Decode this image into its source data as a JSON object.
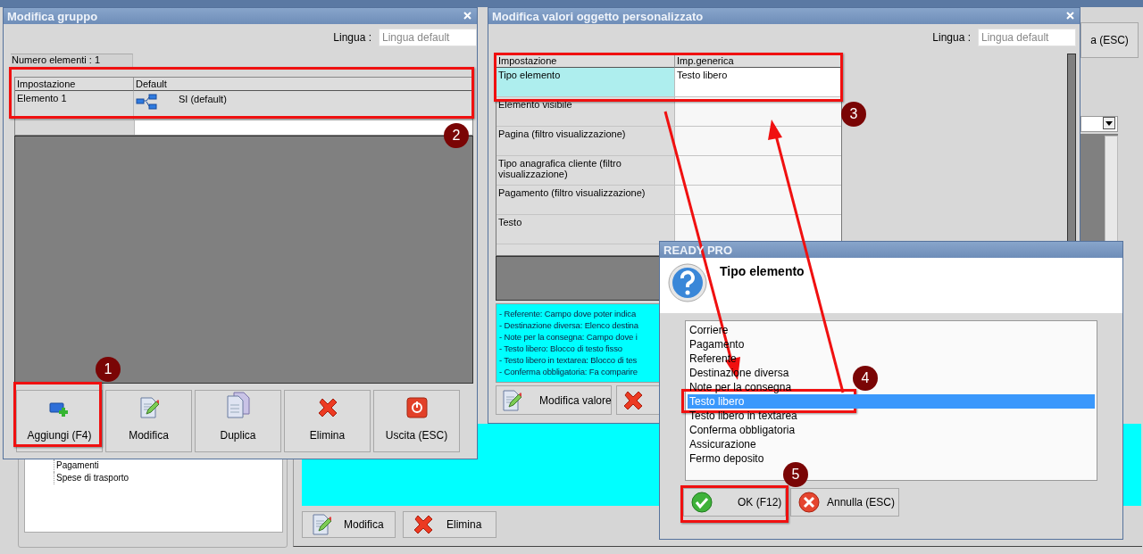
{
  "background_app": {
    "tree_items": [
      {
        "label": "Pagamenti"
      },
      {
        "label": "Spese di trasporto"
      }
    ],
    "top_right_button": "a (ESC)",
    "buttons": [
      {
        "label": "Modifica",
        "kind": "edit"
      },
      {
        "label": "Elimina",
        "kind": "delete"
      }
    ]
  },
  "group_window": {
    "title": "Modifica gruppo",
    "language_label": "Lingua :",
    "language_placeholder": "Lingua default",
    "count": "Numero elementi : 1",
    "table": {
      "columns": [
        "Impostazione",
        "Default"
      ],
      "rows": [
        {
          "cells": [
            "Elemento 1",
            "SI (default)"
          ]
        }
      ]
    },
    "buttons": [
      {
        "label": "Aggiungi (F4)",
        "kind": "add"
      },
      {
        "label": "Modifica",
        "kind": "edit"
      },
      {
        "label": "Duplica",
        "kind": "duplicate"
      },
      {
        "label": "Elimina",
        "kind": "delete"
      },
      {
        "label": "Uscita (ESC)",
        "kind": "exit"
      }
    ]
  },
  "values_window": {
    "title": "Modifica valori oggetto personalizzato",
    "language_label": "Lingua :",
    "language_placeholder": "Lingua default",
    "table": {
      "columns": [
        "Impostazione",
        "Imp.generica"
      ],
      "rows": [
        {
          "cells": [
            "Tipo elemento",
            "Testo libero"
          ],
          "selected": true
        },
        {
          "cells": [
            "Elemento visibile"
          ],
          "selected": false
        },
        {
          "cells": [
            "Pagina (filtro visualizzazione)"
          ],
          "selected": false
        },
        {
          "cells": [
            "Tipo anagrafica cliente (filtro visualizzazione)"
          ],
          "selected": false
        },
        {
          "cells": [
            "Pagamento (filtro visualizzazione)"
          ],
          "selected": false
        },
        {
          "cells": [
            "Testo"
          ],
          "selected": false
        }
      ]
    },
    "help_lines": [
      "- Referente: Campo dove poter indica",
      "- Destinazione diversa: Elenco destina",
      "- Note per la consegna: Campo dove i",
      "- Testo libero: Blocco di testo fisso",
      "- Testo libero in textarea: Blocco di tes",
      "- Conferma obbligatoria: Fa comparire"
    ],
    "buttons": [
      {
        "label": "Modifica valore",
        "kind": "edit"
      },
      {
        "kind": "delete"
      }
    ]
  },
  "dialog": {
    "title": "READY PRO",
    "heading": "Tipo elemento",
    "options": [
      {
        "label": "Corriere",
        "selected": false
      },
      {
        "label": "Pagamento",
        "selected": false
      },
      {
        "label": "Referente",
        "selected": false
      },
      {
        "label": "Destinazione diversa",
        "selected": false
      },
      {
        "label": "Note per la consegna",
        "selected": false
      },
      {
        "label": "Testo libero",
        "selected": true
      },
      {
        "label": "Testo libero in textarea",
        "selected": false
      },
      {
        "label": "Conferma obbligatoria",
        "selected": false
      },
      {
        "label": "Assicurazione",
        "selected": false
      },
      {
        "label": "Fermo deposito",
        "selected": false
      }
    ],
    "buttons": [
      {
        "label": "OK (F12)",
        "kind": "ok"
      },
      {
        "label": "Annulla (ESC)",
        "kind": "cancel"
      }
    ]
  },
  "annotations": {
    "steps": [
      "1",
      "2",
      "3",
      "4",
      "5"
    ]
  }
}
